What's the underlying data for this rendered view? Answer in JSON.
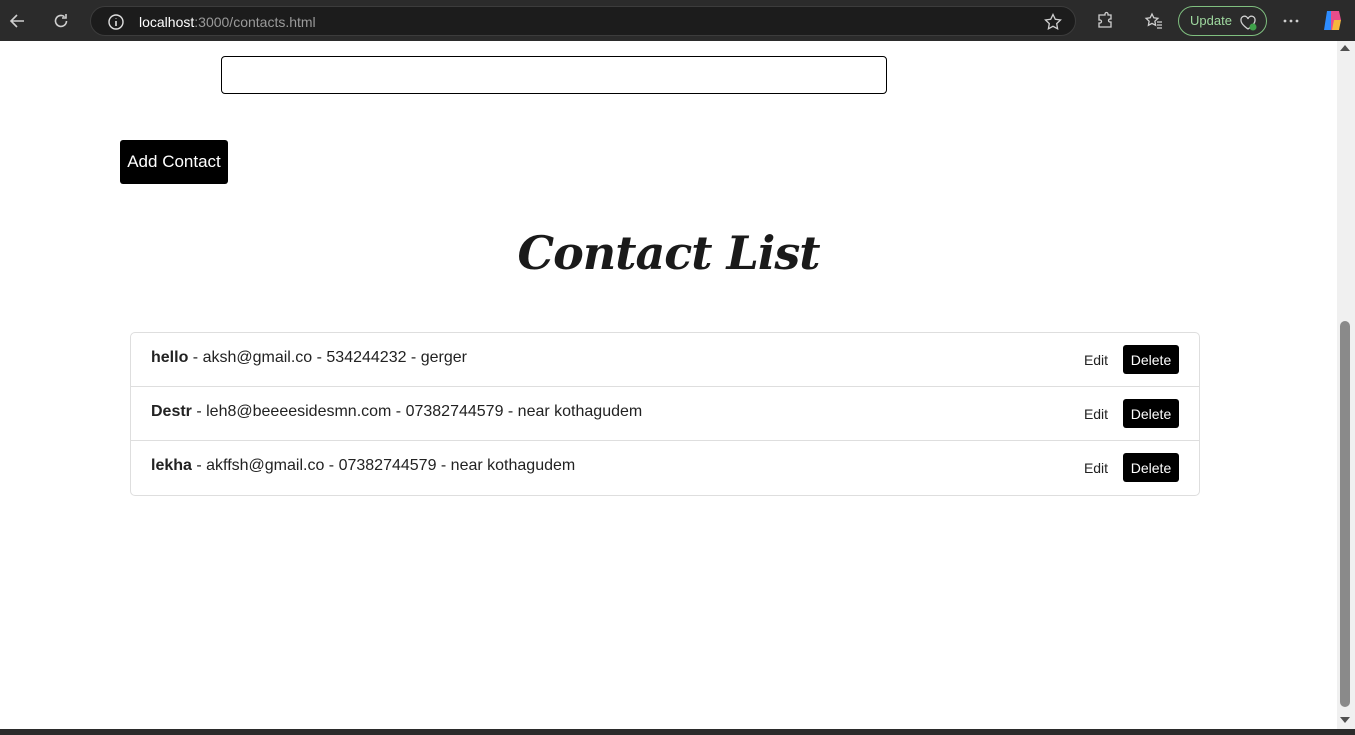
{
  "browser": {
    "url_host": "localhost",
    "url_path": ":3000/contacts.html",
    "update_label": "Update",
    "icons": [
      "back-icon",
      "refresh-icon",
      "info-icon",
      "star-icon",
      "extensions-icon",
      "favorites-icon",
      "heart-pulse-icon",
      "more-icon",
      "copilot-icon"
    ],
    "accent_color": "#7fbf7f"
  },
  "form": {
    "input_value": "",
    "add_button_label": "Add Contact"
  },
  "contact_list": {
    "title": "Contact List",
    "edit_label": "Edit",
    "delete_label": "Delete",
    "contacts": [
      {
        "name": "hello",
        "details": " - aksh@gmail.co - 534244232 - gerger"
      },
      {
        "name": "Destr",
        "details": " - leh8@beeeesidesmn.com - 07382744579 - near kothagudem"
      },
      {
        "name": "lekha",
        "details": " - akffsh@gmail.co - 07382744579 - near kothagudem"
      }
    ]
  }
}
